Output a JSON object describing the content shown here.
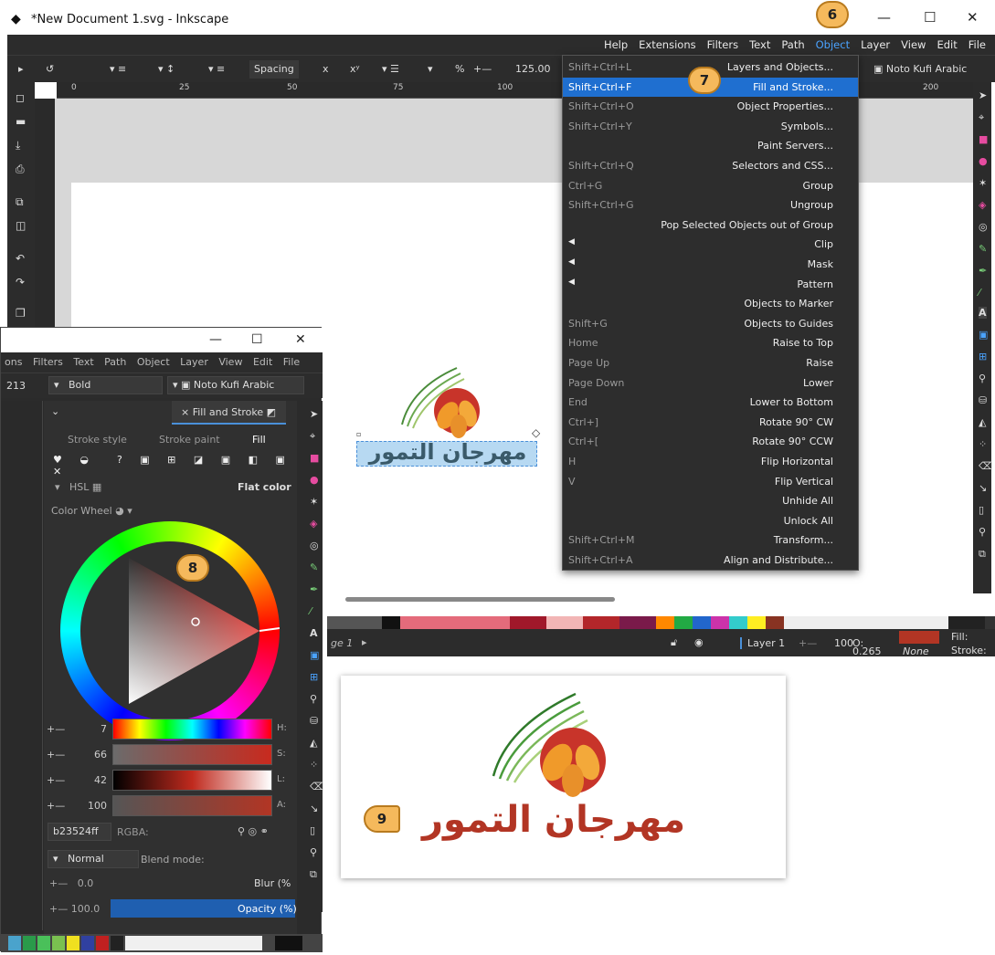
{
  "window": {
    "title": "*New Document 1.svg - Inkscape",
    "controls": [
      "—",
      "☐",
      "✕"
    ]
  },
  "menubar": [
    "Help",
    "Extensions",
    "Filters",
    "Text",
    "Path",
    "Object",
    "Layer",
    "View",
    "Edit",
    "File"
  ],
  "toolbar": {
    "spacing_label": "Spacing",
    "percent": "%",
    "zoom": "125.00",
    "font": "Noto Kufi Arabic"
  },
  "ruler": [
    "0",
    "25",
    "50",
    "75",
    "100",
    "200"
  ],
  "object_menu": [
    {
      "shortcut": "Shift+Ctrl+L",
      "label": "Layers and Objects..."
    },
    {
      "shortcut": "Shift+Ctrl+F",
      "label": "Fill and Stroke...",
      "highlighted": true
    },
    {
      "shortcut": "Shift+Ctrl+O",
      "label": "Object Properties..."
    },
    {
      "shortcut": "Shift+Ctrl+Y",
      "label": "Symbols..."
    },
    {
      "shortcut": "",
      "label": "Paint Servers..."
    },
    {
      "shortcut": "Shift+Ctrl+Q",
      "label": "Selectors and CSS..."
    },
    {
      "shortcut": "Ctrl+G",
      "label": "Group"
    },
    {
      "shortcut": "Shift+Ctrl+G",
      "label": "Ungroup"
    },
    {
      "shortcut": "",
      "label": "Pop Selected Objects out of Group"
    },
    {
      "shortcut": "",
      "label": "Clip",
      "submenu": true
    },
    {
      "shortcut": "",
      "label": "Mask",
      "submenu": true
    },
    {
      "shortcut": "",
      "label": "Pattern",
      "submenu": true
    },
    {
      "shortcut": "",
      "label": "Objects to Marker"
    },
    {
      "shortcut": "Shift+G",
      "label": "Objects to Guides"
    },
    {
      "shortcut": "Home",
      "label": "Raise to Top"
    },
    {
      "shortcut": "Page Up",
      "label": "Raise"
    },
    {
      "shortcut": "Page Down",
      "label": "Lower"
    },
    {
      "shortcut": "End",
      "label": "Lower to Bottom"
    },
    {
      "shortcut": "Ctrl+]",
      "label": "Rotate 90° CW"
    },
    {
      "shortcut": "Ctrl+[",
      "label": "Rotate 90° CCW"
    },
    {
      "shortcut": "H",
      "label": "Flip Horizontal"
    },
    {
      "shortcut": "V",
      "label": "Flip Vertical"
    },
    {
      "shortcut": "",
      "label": "Unhide All"
    },
    {
      "shortcut": "",
      "label": "Unlock All"
    },
    {
      "shortcut": "Shift+Ctrl+M",
      "label": "Transform..."
    },
    {
      "shortcut": "Shift+Ctrl+A",
      "label": "Align and Distribute..."
    }
  ],
  "badges": {
    "b6": "6",
    "b7": "7",
    "b8": "8",
    "b9": "9"
  },
  "logo_text": "مهرجان التمور",
  "status": {
    "page": "ge 1",
    "layer": "Layer 1",
    "opacity_val": "100",
    "o_label": "O:",
    "o_value": "0.265",
    "none": "None",
    "fill": "Fill:",
    "stroke": "Stroke:",
    "fill_color": "#b23524"
  },
  "dialog": {
    "menu": [
      "ons",
      "Filters",
      "Text",
      "Path",
      "Object",
      "Layer",
      "View",
      "Edit",
      "File"
    ],
    "font_size": "213",
    "font_weight": "Bold",
    "font": "Noto Kufi Arabic",
    "tab": "Fill and Stroke",
    "subtabs": {
      "stroke_style": "Stroke style",
      "stroke_paint": "Stroke paint",
      "fill": "Fill"
    },
    "mode": "HSL",
    "flat": "Flat color",
    "wheel": "Color Wheel",
    "sliders": [
      {
        "value": "7",
        "label": "H:"
      },
      {
        "value": "66",
        "label": "S:"
      },
      {
        "value": "42",
        "label": "L:"
      },
      {
        "value": "100",
        "label": "A:"
      }
    ],
    "rgba": "b23524ff",
    "rgba_label": "RGBA:",
    "blend": "Normal",
    "blend_label": "Blend mode:",
    "blur": "0.0",
    "blur_label": "Blur (%",
    "opacity": "100.0",
    "opacity_label": "Opacity (%)"
  }
}
